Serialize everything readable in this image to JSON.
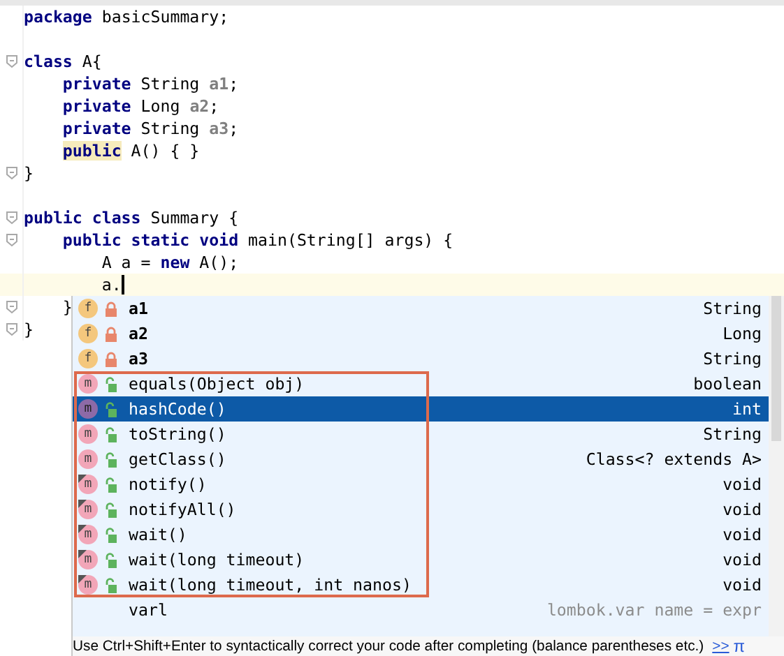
{
  "editor": {
    "lines": [
      {
        "fold": false,
        "current": false,
        "tokens": [
          {
            "text": "package",
            "kind": "kw"
          },
          {
            "text": " basicSummary;",
            "kind": "plain"
          }
        ]
      },
      {
        "fold": false,
        "current": false
      },
      {
        "fold": true,
        "current": false,
        "tokens": [
          {
            "text": "class",
            "kind": "kw"
          },
          {
            "text": " A{",
            "kind": "plain"
          }
        ]
      },
      {
        "fold": false,
        "current": false,
        "tokens": [
          {
            "text": "    private",
            "kind": "kw"
          },
          {
            "text": " String ",
            "kind": "plain"
          },
          {
            "text": "a1",
            "kind": "unused"
          },
          {
            "text": ";",
            "kind": "plain"
          }
        ]
      },
      {
        "fold": false,
        "current": false,
        "tokens": [
          {
            "text": "    private",
            "kind": "kw"
          },
          {
            "text": " Long ",
            "kind": "plain"
          },
          {
            "text": "a2",
            "kind": "unused"
          },
          {
            "text": ";",
            "kind": "plain"
          }
        ]
      },
      {
        "fold": false,
        "current": false,
        "tokens": [
          {
            "text": "    private",
            "kind": "kw"
          },
          {
            "text": " String ",
            "kind": "plain"
          },
          {
            "text": "a3",
            "kind": "unused"
          },
          {
            "text": ";",
            "kind": "plain"
          }
        ]
      },
      {
        "fold": false,
        "current": false,
        "tokens": [
          {
            "text": "    public",
            "kind": "kw_marked"
          },
          {
            "text": " A() { }",
            "kind": "plain"
          }
        ]
      },
      {
        "fold": true,
        "current": false,
        "tokens": [
          {
            "text": "}",
            "kind": "plain"
          }
        ]
      },
      {
        "fold": false,
        "current": false
      },
      {
        "fold": true,
        "current": false,
        "tokens": [
          {
            "text": "public class",
            "kind": "kw"
          },
          {
            "text": " Summary {",
            "kind": "plain"
          }
        ]
      },
      {
        "fold": true,
        "current": false,
        "tokens": [
          {
            "text": "    public static void",
            "kind": "kw"
          },
          {
            "text": " main(String[] args) {",
            "kind": "plain"
          }
        ]
      },
      {
        "fold": false,
        "current": false,
        "tokens": [
          {
            "text": "        A a = ",
            "kind": "plain"
          },
          {
            "text": "new",
            "kind": "kw"
          },
          {
            "text": " A();",
            "kind": "plain"
          }
        ]
      },
      {
        "fold": false,
        "current": true,
        "tokens": [
          {
            "text": "        a.",
            "kind": "plain"
          }
        ]
      },
      {
        "fold": true,
        "current": false,
        "tokens": [
          {
            "text": "    }",
            "kind": "plain"
          }
        ]
      },
      {
        "fold": true,
        "current": false,
        "tokens": [
          {
            "text": "}",
            "kind": "plain"
          }
        ]
      }
    ]
  },
  "completion": {
    "items": [
      {
        "kind": "field",
        "icon": "f",
        "name": "a1",
        "type": "String",
        "selected": false,
        "inherited": false,
        "boxed": false
      },
      {
        "kind": "field",
        "icon": "f",
        "name": "a2",
        "type": "Long",
        "selected": false,
        "inherited": false,
        "boxed": false
      },
      {
        "kind": "field",
        "icon": "f",
        "name": "a3",
        "type": "String",
        "selected": false,
        "inherited": false,
        "boxed": false
      },
      {
        "kind": "method",
        "icon": "m",
        "name": "equals(Object obj)",
        "type": "boolean",
        "selected": false,
        "inherited": false,
        "boxed": true
      },
      {
        "kind": "method",
        "icon": "m",
        "name": "hashCode()",
        "type": "int",
        "selected": true,
        "inherited": false,
        "boxed": true
      },
      {
        "kind": "method",
        "icon": "m",
        "name": "toString()",
        "type": "String",
        "selected": false,
        "inherited": false,
        "boxed": true
      },
      {
        "kind": "method",
        "icon": "m",
        "name": "getClass()",
        "type": "Class<? extends A>",
        "selected": false,
        "inherited": false,
        "boxed": true
      },
      {
        "kind": "method",
        "icon": "m",
        "name": "notify()",
        "type": "void",
        "selected": false,
        "inherited": true,
        "boxed": true
      },
      {
        "kind": "method",
        "icon": "m",
        "name": "notifyAll()",
        "type": "void",
        "selected": false,
        "inherited": true,
        "boxed": true
      },
      {
        "kind": "method",
        "icon": "m",
        "name": "wait()",
        "type": "void",
        "selected": false,
        "inherited": true,
        "boxed": true
      },
      {
        "kind": "method",
        "icon": "m",
        "name": "wait(long timeout)",
        "type": "void",
        "selected": false,
        "inherited": true,
        "boxed": true
      },
      {
        "kind": "method",
        "icon": "m",
        "name": "wait(long timeout, int nanos)",
        "type": "void",
        "selected": false,
        "inherited": true,
        "boxed": true
      },
      {
        "kind": "template",
        "name": "varl",
        "type": "lombok.var name = expr",
        "selected": false,
        "boxed": false
      }
    ],
    "hint": "Use Ctrl+Shift+Enter to syntactically correct your code after completing (balance parentheses etc.)",
    "hint_link": ">>",
    "hint_icon": "π"
  }
}
